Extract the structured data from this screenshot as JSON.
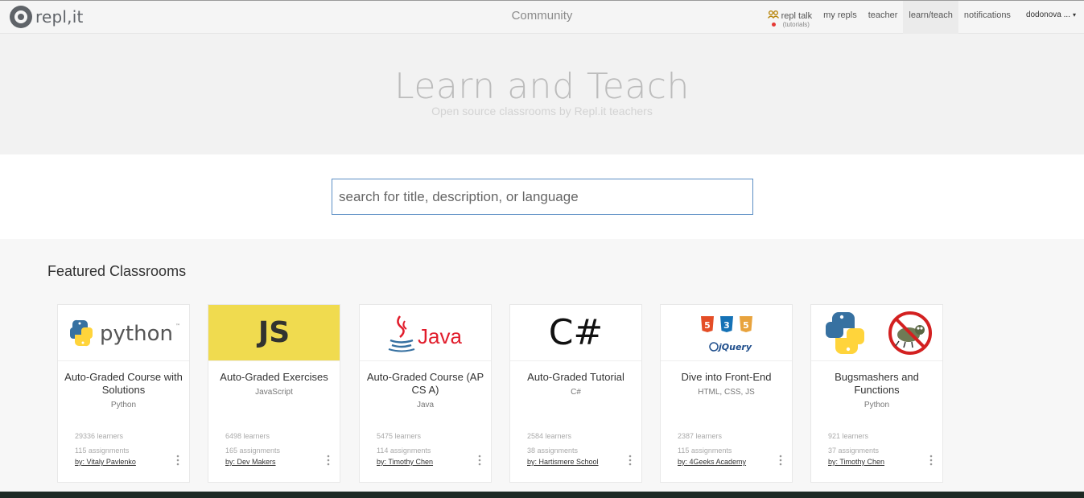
{
  "nav": {
    "logo_text": "repl,it",
    "center": "Community",
    "repl_talk": "repl talk",
    "repl_talk_sub": "(tutorials)",
    "links": [
      "my repls",
      "teacher",
      "learn/teach",
      "notifications"
    ],
    "user": "dodonova ...",
    "caret": "▾"
  },
  "hero": {
    "title": "Learn and Teach",
    "subtitle": "Open source classrooms by Repl.it teachers"
  },
  "search": {
    "placeholder": "search for title, description, or language"
  },
  "featured": {
    "title": "Featured Classrooms",
    "cards": [
      {
        "title": "Auto-Graded Course with Solutions",
        "language": "Python",
        "learners": "29336 learners",
        "assignments": "115 assignments",
        "author": "by: Vitaly Pavlenko"
      },
      {
        "title": "Auto-Graded Exercises",
        "language": "JavaScript",
        "learners": "6498 learners",
        "assignments": "165 assignments",
        "author": "by: Dev Makers"
      },
      {
        "title": "Auto-Graded Course (AP CS A)",
        "language": "Java",
        "learners": "5475 learners",
        "assignments": "114 assignments",
        "author": "by: Timothy Chen"
      },
      {
        "title": "Auto-Graded Tutorial",
        "language": "C#",
        "learners": "2584 learners",
        "assignments": "38 assignments",
        "author": "by: Hartismere School"
      },
      {
        "title": "Dive into Front-End",
        "language": "HTML, CSS, JS",
        "learners": "2387 learners",
        "assignments": "115 assignments",
        "author": "by: 4Geeks Academy"
      },
      {
        "title": "Bugsmashers and Functions",
        "language": "Python",
        "learners": "921 learners",
        "assignments": "37 assignments",
        "author": "by: Timothy Chen"
      }
    ]
  },
  "logos": {
    "python_word": "python",
    "tm": "™",
    "js": "JS",
    "java": "Java",
    "csharp": "C#",
    "jquery": "jQuery",
    "html5": "5",
    "css3": "3",
    "js5": "5"
  },
  "colors": {
    "js_yellow": "#f0db4f",
    "java_red": "#e11d2c",
    "python_blue": "#3771a1",
    "python_yellow": "#ffd43b",
    "html_orange": "#e44d26",
    "css_blue": "#1572b6"
  }
}
